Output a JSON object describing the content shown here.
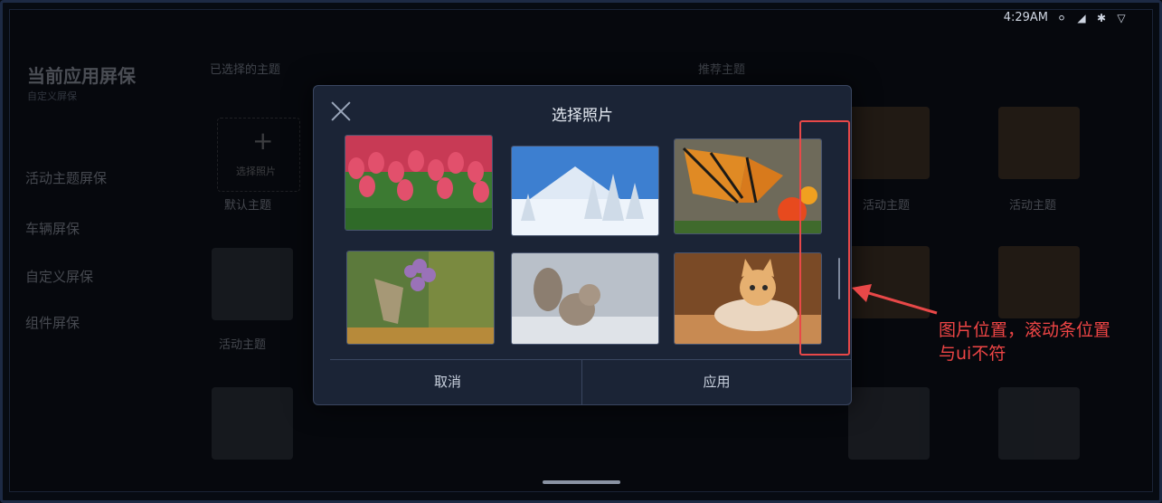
{
  "status_bar": {
    "time": "4:29AM"
  },
  "background_app": {
    "title": "当前应用屏保",
    "subtitle": "自定义屏保",
    "menu": [
      "活动主题屏保",
      "车辆屏保",
      "自定义屏保",
      "组件屏保"
    ],
    "section_left": "已选择的主题",
    "section_right": "推荐主题",
    "add_tile_label": "选择照片",
    "tile_labels": [
      "默认主题",
      "活动主题",
      "活动主题",
      "活动主题"
    ]
  },
  "dialog": {
    "title": "选择照片",
    "photos": [
      {
        "subject": "tulips"
      },
      {
        "subject": "snowy mountain"
      },
      {
        "subject": "monarch butterfly"
      },
      {
        "subject": "butterfly on flower"
      },
      {
        "subject": "squirrel"
      },
      {
        "subject": "kitten"
      }
    ],
    "cancel_label": "取消",
    "apply_label": "应用"
  },
  "annotation": {
    "text_line1": "图片位置，滚动条位置",
    "text_line2": "与ui不符",
    "color": "#e84848"
  }
}
